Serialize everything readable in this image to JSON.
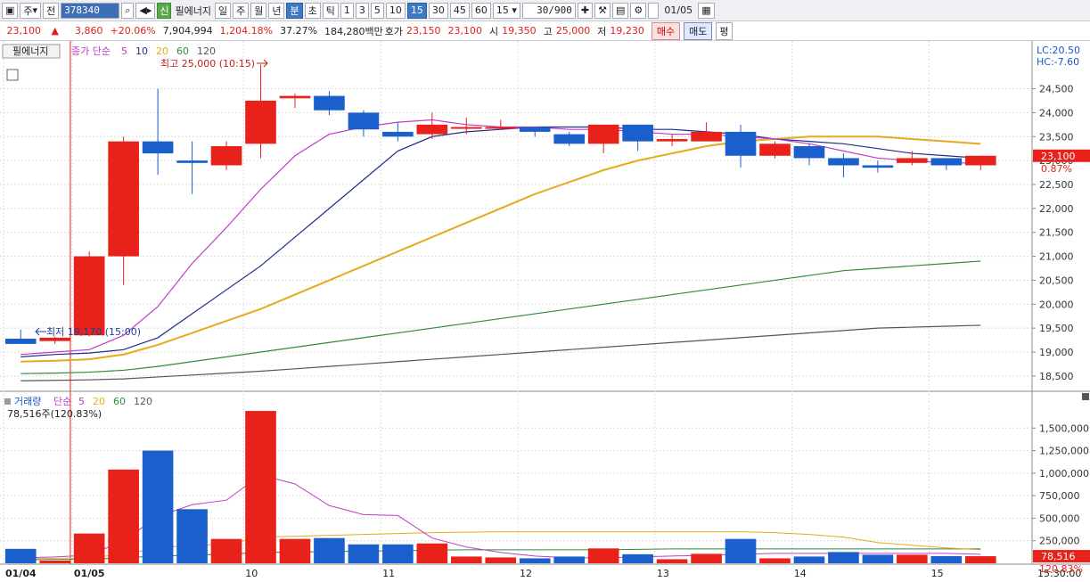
{
  "toolbar": {
    "market_type": "주",
    "market_all": "전",
    "stock_code": "378340",
    "sin_badge": "신",
    "stock_name": "필에너지",
    "period_buttons": [
      "일",
      "주",
      "월",
      "년",
      "분",
      "초",
      "틱"
    ],
    "active_period": "분",
    "interval_buttons": [
      "1",
      "3",
      "5",
      "10",
      "15",
      "30",
      "45",
      "60"
    ],
    "active_interval": "15",
    "interval_select": "15",
    "counter": "30/900",
    "date": "01/05"
  },
  "info": {
    "price": "23,100",
    "change": "3,860",
    "change_pct": "+20.06%",
    "volume": "7,904,994",
    "volume_ratio": "1,204.18%",
    "turnover": "37.27%",
    "amount": "184,280백만",
    "ask_label": "호가",
    "ask": "23,150",
    "bid": "23,100",
    "open_label": "시",
    "open": "19,350",
    "high_label": "고",
    "high": "25,000",
    "low_label": "저",
    "low": "19,230",
    "buy_label": "매수",
    "sell_label": "매도",
    "eval_label": "평"
  },
  "price_panel": {
    "name_tag": "필에너지",
    "ma_title": "종가 단순",
    "ma_periods": [
      "5",
      "10",
      "20",
      "60",
      "120"
    ],
    "high_annotation": "최고 25,000 (10:15)",
    "low_annotation": "최저 19,170 (15:00)",
    "lc_label": "LC:20.50",
    "hc_label": "HC:-7.60",
    "current_price_label": "23,100",
    "current_pct_label": "0.87%"
  },
  "volume_panel": {
    "title": "거래량",
    "ma_title": "단순",
    "ma_periods": [
      "5",
      "20",
      "60",
      "120"
    ],
    "info_line": "78,516주(120.83%)",
    "current_label": "78,516",
    "current_pct_label": "120.83%"
  },
  "colors": {
    "up": "#e8221a",
    "down": "#1b5fcc",
    "ma5": "#c23cc6",
    "ma10": "#1f2d8a",
    "ma20": "#e6aa1e",
    "ma60": "#2f8b3a",
    "ma120": "#555555"
  },
  "chart_data": {
    "type": "candlestick",
    "price_axis": {
      "ticks": [
        18500,
        19000,
        19500,
        20000,
        20500,
        21000,
        21500,
        22000,
        22500,
        23000,
        23500,
        24000,
        24500
      ],
      "tick_labels": [
        "18,500",
        "19,000",
        "19,500",
        "20,000",
        "20,500",
        "21,000",
        "21,500",
        "22,000",
        "22,500",
        "23,000",
        "23,500",
        "24,000",
        "24,500"
      ]
    },
    "volume_axis": {
      "ticks": [
        250000,
        500000,
        750000,
        1000000,
        1250000,
        1500000
      ],
      "tick_labels": [
        "250,000",
        "500,000",
        "750,000",
        "1,000,000",
        "1,250,000",
        "1,500,000"
      ]
    },
    "x_labels": [
      "01/04",
      "01/05",
      "10",
      "11",
      "12",
      "13",
      "14",
      "15"
    ],
    "time_label": "15:30:00",
    "candles": [
      {
        "o": 19280,
        "h": 19470,
        "l": 19170,
        "c": 19170
      },
      {
        "o": 19230,
        "h": 19320,
        "l": 19170,
        "c": 19300
      },
      {
        "o": 19350,
        "h": 21100,
        "l": 19330,
        "c": 21000
      },
      {
        "o": 21000,
        "h": 23500,
        "l": 20400,
        "c": 23400
      },
      {
        "o": 23400,
        "h": 24500,
        "l": 22700,
        "c": 23150
      },
      {
        "o": 23000,
        "h": 23400,
        "l": 22300,
        "c": 22950
      },
      {
        "o": 22900,
        "h": 23400,
        "l": 22800,
        "c": 23300
      },
      {
        "o": 23350,
        "h": 25000,
        "l": 23050,
        "c": 24250
      },
      {
        "o": 24300,
        "h": 24400,
        "l": 24100,
        "c": 24350
      },
      {
        "o": 24350,
        "h": 24450,
        "l": 23950,
        "c": 24050
      },
      {
        "o": 24000,
        "h": 24050,
        "l": 23500,
        "c": 23650
      },
      {
        "o": 23600,
        "h": 23800,
        "l": 23400,
        "c": 23500
      },
      {
        "o": 23550,
        "h": 24000,
        "l": 23450,
        "c": 23750
      },
      {
        "o": 23700,
        "h": 23900,
        "l": 23550,
        "c": 23700
      },
      {
        "o": 23700,
        "h": 23850,
        "l": 23650,
        "c": 23700
      },
      {
        "o": 23700,
        "h": 23700,
        "l": 23500,
        "c": 23600
      },
      {
        "o": 23550,
        "h": 23600,
        "l": 23300,
        "c": 23350
      },
      {
        "o": 23350,
        "h": 23750,
        "l": 23150,
        "c": 23750
      },
      {
        "o": 23750,
        "h": 23750,
        "l": 23200,
        "c": 23400
      },
      {
        "o": 23400,
        "h": 23550,
        "l": 23300,
        "c": 23450
      },
      {
        "o": 23400,
        "h": 23800,
        "l": 23400,
        "c": 23600
      },
      {
        "o": 23600,
        "h": 23750,
        "l": 22850,
        "c": 23100
      },
      {
        "o": 23100,
        "h": 23400,
        "l": 23050,
        "c": 23350
      },
      {
        "o": 23300,
        "h": 23350,
        "l": 22900,
        "c": 23050
      },
      {
        "o": 23050,
        "h": 23150,
        "l": 22650,
        "c": 22900
      },
      {
        "o": 22900,
        "h": 23000,
        "l": 22750,
        "c": 22850
      },
      {
        "o": 22950,
        "h": 23200,
        "l": 22900,
        "c": 23050
      },
      {
        "o": 23050,
        "h": 23050,
        "l": 22800,
        "c": 22900
      },
      {
        "o": 22900,
        "h": 23000,
        "l": 22800,
        "c": 23100
      }
    ],
    "volumes": [
      160000,
      30000,
      330000,
      1040000,
      1250000,
      600000,
      270000,
      1690000,
      270000,
      280000,
      210000,
      210000,
      220000,
      75000,
      65000,
      55000,
      75000,
      165000,
      100000,
      45000,
      105000,
      270000,
      55000,
      75000,
      125000,
      95000,
      95000,
      80000,
      78516
    ],
    "ma": {
      "ma5": [
        18950,
        19000,
        19050,
        19350,
        19950,
        20850,
        21600,
        22400,
        23100,
        23550,
        23700,
        23800,
        23850,
        23750,
        23700,
        23700,
        23650,
        23650,
        23600,
        23550,
        23550,
        23500,
        23450,
        23350,
        23200,
        23050,
        23000,
        22950,
        22950
      ],
      "ma10": [
        18900,
        18950,
        18980,
        19050,
        19300,
        19800,
        20300,
        20800,
        21400,
        22000,
        22600,
        23200,
        23500,
        23600,
        23650,
        23700,
        23700,
        23700,
        23650,
        23650,
        23600,
        23550,
        23450,
        23400,
        23350,
        23250,
        23150,
        23100,
        23050
      ],
      "ma20": [
        18800,
        18820,
        18850,
        18950,
        19150,
        19400,
        19650,
        19900,
        20200,
        20500,
        20800,
        21100,
        21400,
        21700,
        22000,
        22300,
        22550,
        22800,
        23000,
        23150,
        23300,
        23400,
        23450,
        23500,
        23500,
        23500,
        23450,
        23400,
        23350
      ],
      "ma60": [
        18550,
        18560,
        18580,
        18620,
        18700,
        18800,
        18900,
        19000,
        19100,
        19200,
        19300,
        19400,
        19500,
        19600,
        19700,
        19800,
        19900,
        20000,
        20100,
        20200,
        20300,
        20400,
        20500,
        20600,
        20700,
        20750,
        20800,
        20850,
        20900
      ],
      "ma120": [
        18400,
        18410,
        18420,
        18440,
        18480,
        18520,
        18560,
        18600,
        18650,
        18700,
        18750,
        18800,
        18850,
        18900,
        18950,
        19000,
        19050,
        19100,
        19150,
        19200,
        19250,
        19300,
        19350,
        19400,
        19450,
        19500,
        19520,
        19540,
        19560
      ]
    },
    "vol_ma": {
      "ma5": [
        60000,
        70000,
        90000,
        250000,
        520000,
        650000,
        700000,
        980000,
        880000,
        640000,
        540000,
        530000,
        280000,
        180000,
        120000,
        80000,
        60000,
        60000,
        70000,
        80000,
        90000,
        100000,
        110000,
        110000,
        110000,
        110000,
        110000,
        110000,
        100000
      ],
      "ma20": [
        50000,
        55000,
        60000,
        100000,
        170000,
        200000,
        210000,
        290000,
        300000,
        310000,
        320000,
        330000,
        340000,
        345000,
        350000,
        350000,
        350000,
        350000,
        350000,
        350000,
        350000,
        350000,
        340000,
        320000,
        290000,
        230000,
        200000,
        170000,
        150000
      ],
      "ma60": [
        40000,
        42000,
        45000,
        60000,
        80000,
        90000,
        100000,
        120000,
        125000,
        130000,
        135000,
        140000,
        145000,
        150000,
        150000,
        150000,
        150000,
        150000,
        155000,
        160000,
        160000,
        160000,
        160000,
        160000,
        160000,
        160000,
        160000,
        160000,
        160000
      ]
    }
  }
}
